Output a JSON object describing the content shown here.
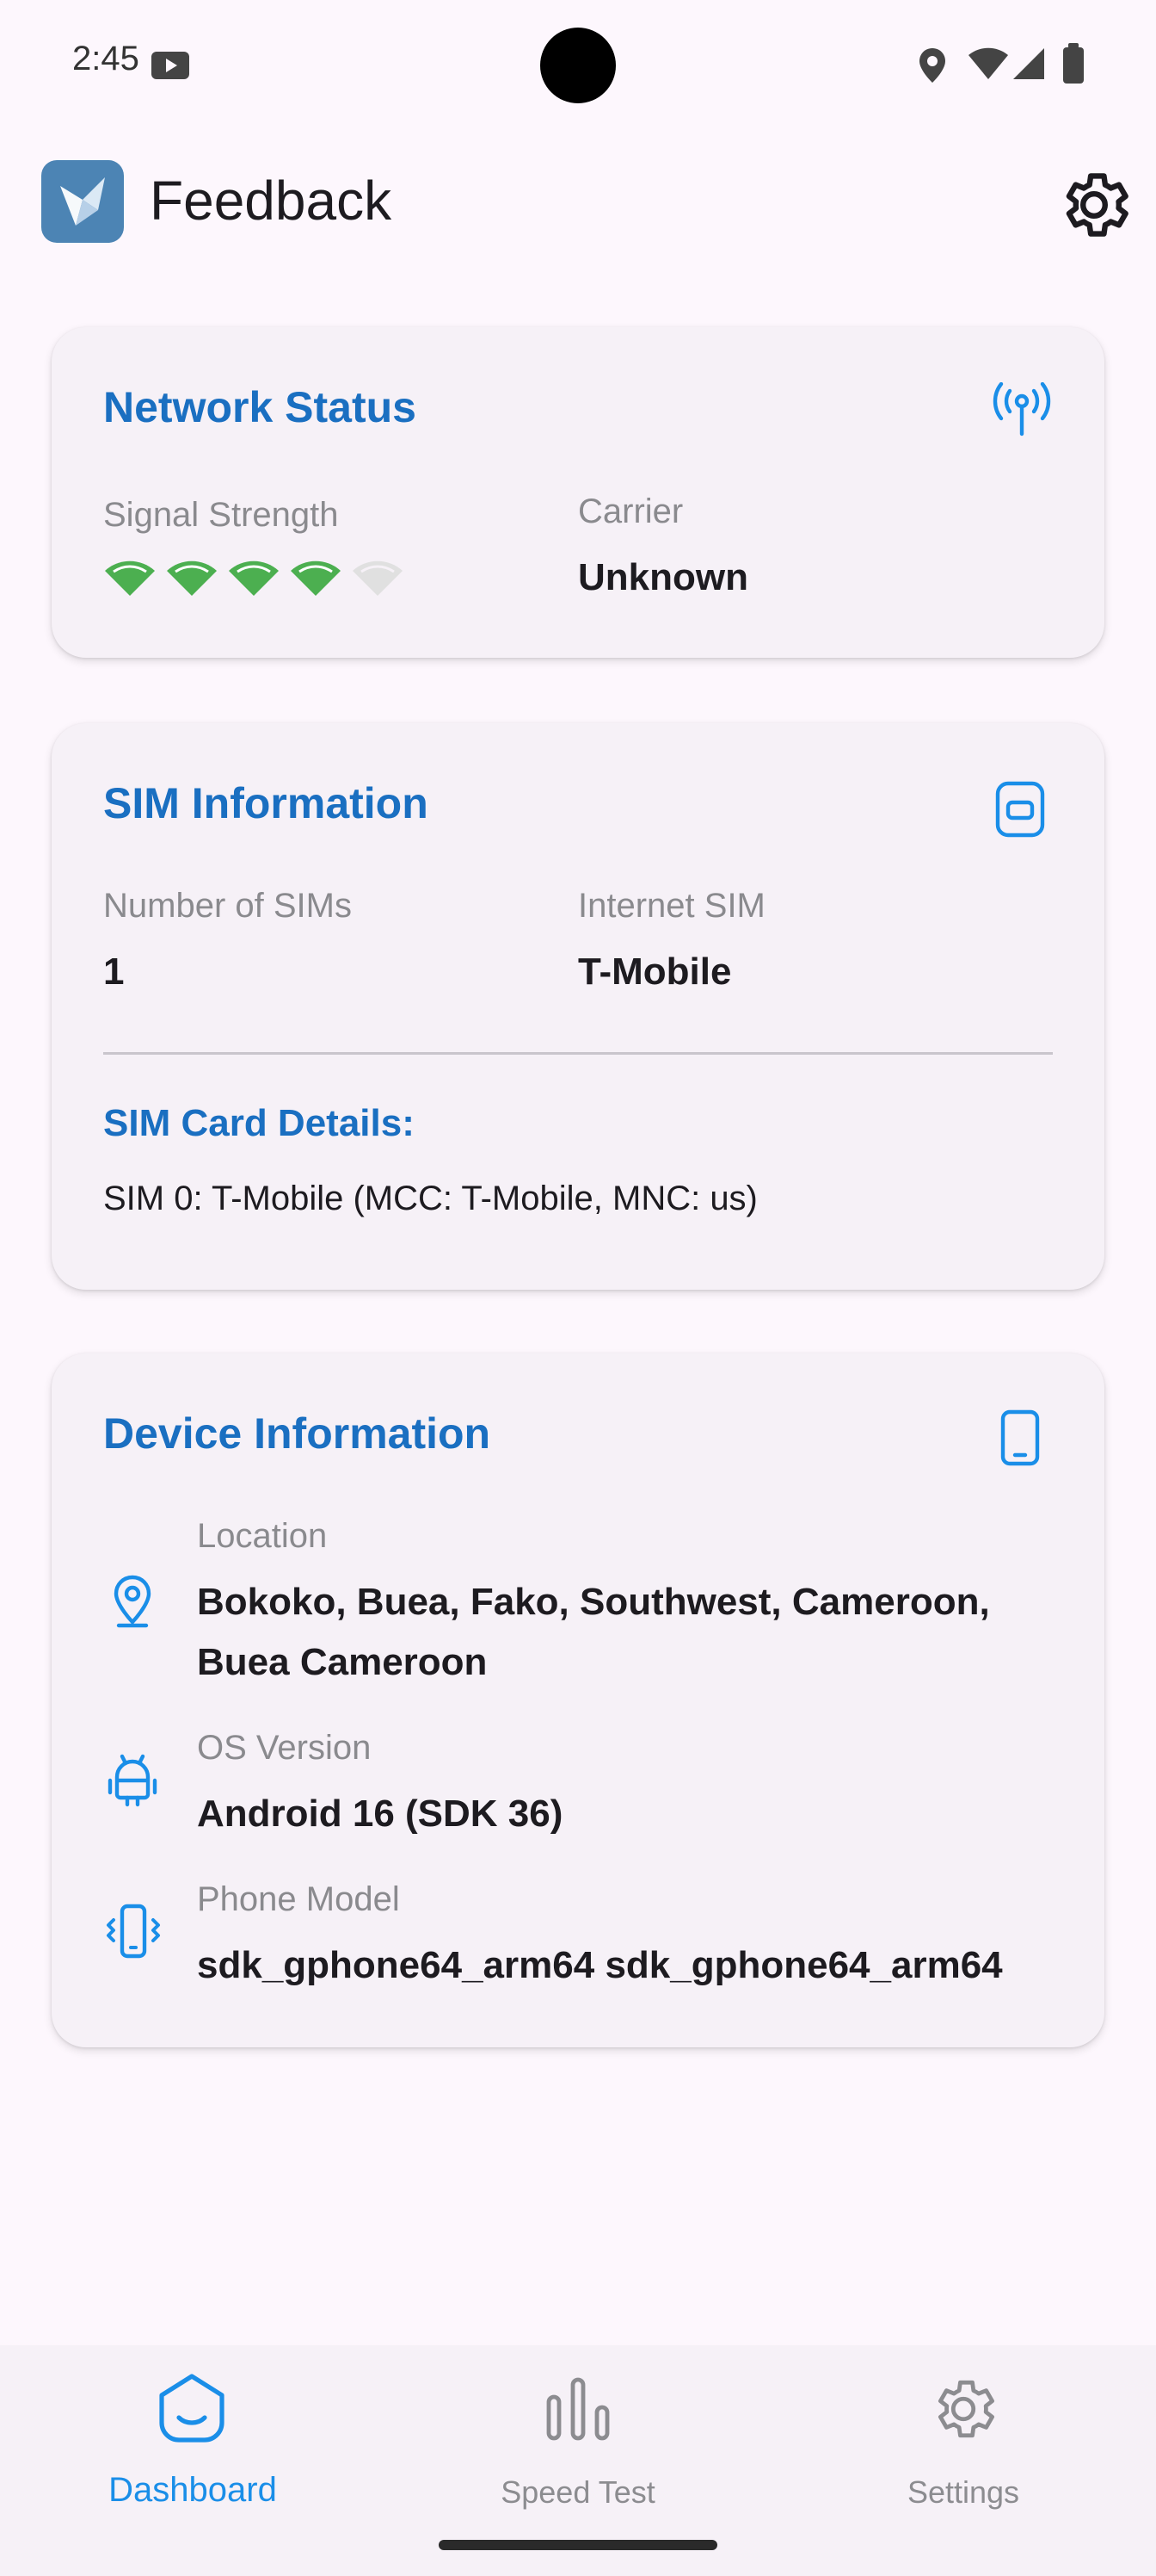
{
  "status_bar": {
    "time": "2:45"
  },
  "app_bar": {
    "title": "Feedback"
  },
  "network": {
    "title": "Network Status",
    "signal_label": "Signal Strength",
    "signal_bars_total": 5,
    "signal_bars_filled": 4,
    "carrier_label": "Carrier",
    "carrier_value": "Unknown"
  },
  "sim": {
    "title": "SIM Information",
    "num_label": "Number of SIMs",
    "num_value": "1",
    "internet_label": "Internet SIM",
    "internet_value": "T-Mobile",
    "details_title": "SIM Card Details:",
    "details_line": "SIM 0: T-Mobile (MCC: T-Mobile, MNC: us)"
  },
  "device": {
    "title": "Device Information",
    "location_label": "Location",
    "location_line1": "Bokoko, Buea, Fako, Southwest, Cameroon,",
    "location_line2": "Buea Cameroon",
    "os_label": "OS Version",
    "os_value": "Android 16 (SDK 36)",
    "model_label": "Phone Model",
    "model_value": "sdk_gphone64_arm64 sdk_gphone64_arm64"
  },
  "nav": {
    "items": [
      {
        "label": "Dashboard",
        "icon": "dashboard-icon",
        "active": true
      },
      {
        "label": "Speed Test",
        "icon": "bar-chart-icon",
        "active": false
      },
      {
        "label": "Settings",
        "icon": "gear-icon",
        "active": false
      }
    ]
  },
  "colors": {
    "accent": "#1a6fc1",
    "signal_on": "#4caf50",
    "signal_off": "#e0e0e0",
    "background": "#fdf7fd"
  }
}
